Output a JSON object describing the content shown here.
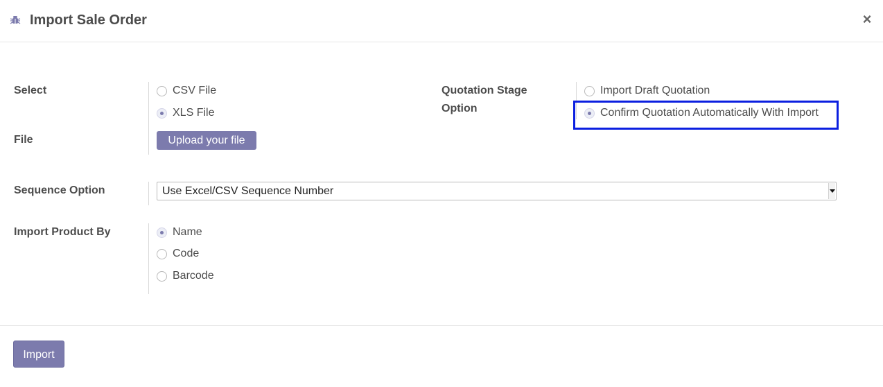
{
  "dialog": {
    "title": "Import Sale Order",
    "close_label": "×"
  },
  "select_section": {
    "label": "Select",
    "options": [
      {
        "label": "CSV File",
        "checked": false
      },
      {
        "label": "XLS File",
        "checked": true
      }
    ]
  },
  "file_section": {
    "label": "File",
    "upload_label": "Upload your file"
  },
  "quotation_stage": {
    "label_line1": "Quotation Stage",
    "label_line2": "Option",
    "options": [
      {
        "label": "Import Draft Quotation",
        "checked": false
      },
      {
        "label": "Confirm Quotation Automatically With Import",
        "checked": true
      }
    ]
  },
  "sequence_option": {
    "label": "Sequence Option",
    "selected": "Use Excel/CSV Sequence Number"
  },
  "import_product_by": {
    "label": "Import Product By",
    "options": [
      {
        "label": "Name",
        "checked": true
      },
      {
        "label": "Code",
        "checked": false
      },
      {
        "label": "Barcode",
        "checked": false
      }
    ]
  },
  "footer": {
    "import_label": "Import"
  },
  "colors": {
    "accent": "#7c7bad",
    "highlight_border": "#0b1fe0"
  },
  "icons": {
    "title_icon": "bug-icon",
    "close_icon": "close-icon"
  }
}
